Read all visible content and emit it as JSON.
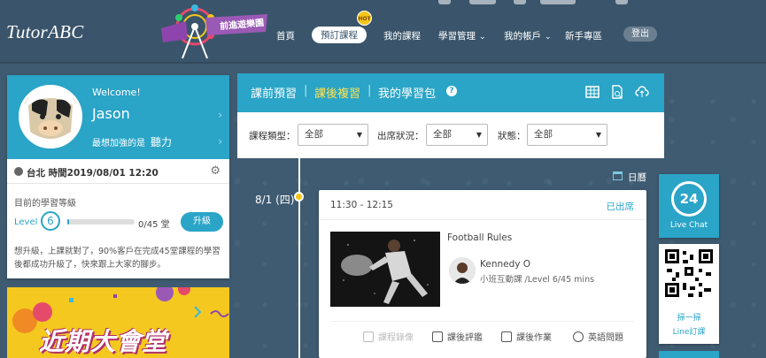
{
  "header": {
    "logo": "TutorABC",
    "promo_badge": "前進遊樂園",
    "hot_badge": "HOT",
    "nav": [
      {
        "label": "首頁"
      },
      {
        "label": "預訂課程"
      },
      {
        "label": "我的課程"
      },
      {
        "label": "學習管理"
      },
      {
        "label": "我的帳戶"
      },
      {
        "label": "新手專區"
      }
    ],
    "logout": "登出"
  },
  "profile": {
    "welcome": "Welcome!",
    "name": "Jason",
    "strong_label": "最想加強的是",
    "strong_value": "聽力",
    "time": "台北 時間2019/08/01 12:20",
    "level_title": "目前的學習等級",
    "level_label": "Level",
    "level_number": "6",
    "progress_count": "0/45 堂",
    "progress_fraction": 0.02,
    "upgrade_button": "升級",
    "upgrade_message": "想升級，上課就對了，90%客戶在完成45堂課程的學習後都成功升級了，快來跟上大家的腳步。"
  },
  "banner": {
    "title": "近期大會堂"
  },
  "main": {
    "tabs": [
      {
        "label": "課前預習"
      },
      {
        "label": "課後複習"
      },
      {
        "label": "我的學習包"
      }
    ],
    "filters": [
      {
        "label": "課程類型：",
        "value": "全部"
      },
      {
        "label": "出席狀況：",
        "value": "全部"
      },
      {
        "label": "狀態：",
        "value": "全部"
      }
    ],
    "calendar_label": "日曆",
    "date": "8/1 (四)",
    "session": {
      "time": "11:30 - 12:15",
      "status": "已出席",
      "title": "Football Rules",
      "tutor": "Kennedy O",
      "info": "小班互動課 /Level 6/45 mins",
      "actions": [
        {
          "label": "課程錄像"
        },
        {
          "label": "課後評鑑"
        },
        {
          "label": "課後作業"
        },
        {
          "label": "英語問題"
        }
      ]
    }
  },
  "widgets": {
    "livechat_number": "24",
    "livechat_label": "Live Chat",
    "qr_line1": "掃一掃",
    "qr_line2": "Line訂課"
  },
  "colors": {
    "accent": "#2aa4c7",
    "header_bg": "#3a556b",
    "highlight_tab": "#ffe34d",
    "banner": "#f4c81f",
    "dot": "#f5c518"
  }
}
